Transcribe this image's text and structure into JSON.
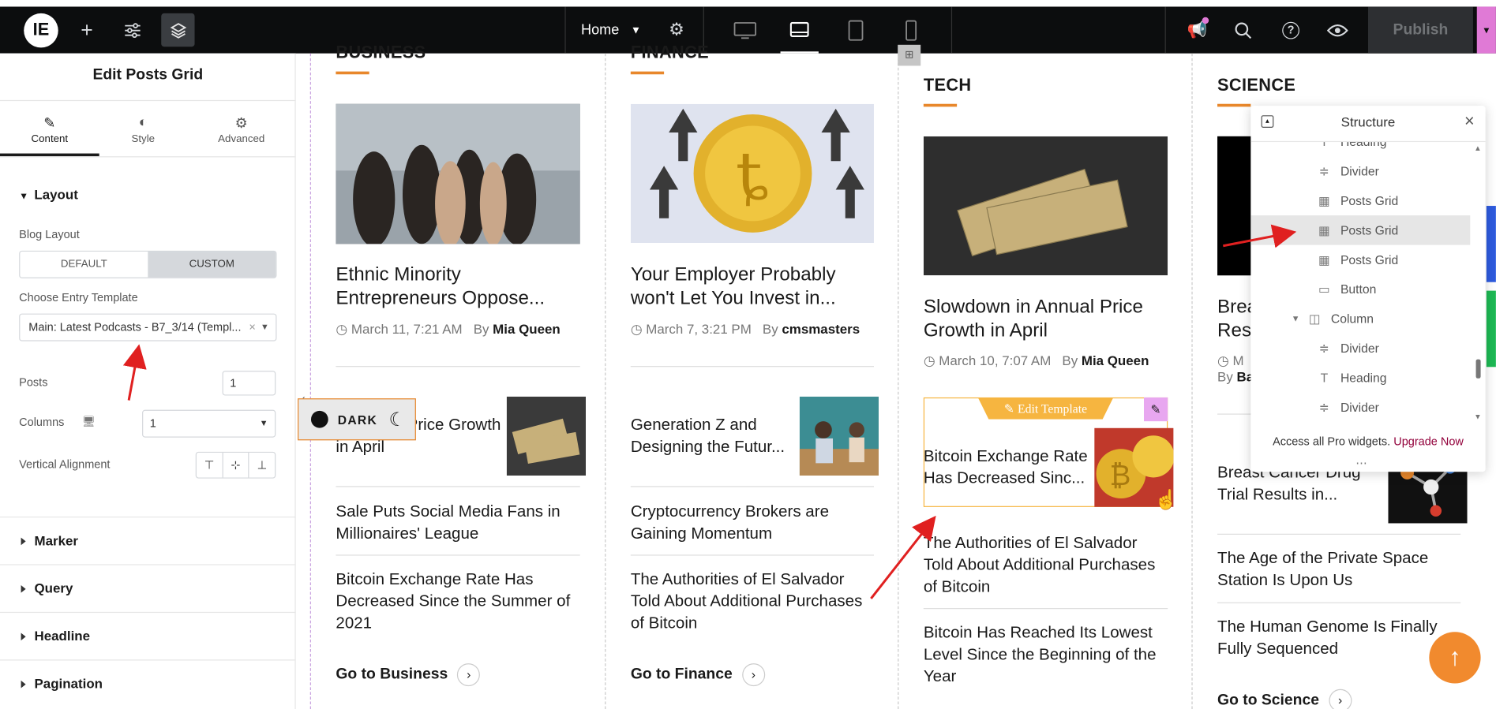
{
  "topbar": {
    "page_label": "Home",
    "publish_label": "Publish"
  },
  "panel": {
    "title": "Edit Posts Grid",
    "tabs": [
      {
        "label": "Content"
      },
      {
        "label": "Style"
      },
      {
        "label": "Advanced"
      }
    ],
    "layout_section": "Layout",
    "blog_layout_label": "Blog Layout",
    "blog_layout_options": [
      "DEFAULT",
      "CUSTOM"
    ],
    "entry_template_label": "Choose Entry Template",
    "entry_template_value": "Main: Latest Podcasts - B7_3/14 (Templ...",
    "posts_label": "Posts",
    "posts_value": "1",
    "columns_label": "Columns",
    "columns_value": "1",
    "valign_label": "Vertical Alignment",
    "sections": [
      "Marker",
      "Query",
      "Headline",
      "Pagination"
    ]
  },
  "dark_toggle": "DARK",
  "columns": [
    {
      "category": "BUSINESS",
      "feature_title": "Ethnic Minority Entrepreneurs Oppose...",
      "feature_date": "March 11, 7:21 AM",
      "feature_author": "Mia Queen",
      "list": [
        "in Annual Price Growth in April",
        "Sale Puts Social Media Fans in Millionaires' League",
        "Bitcoin Exchange Rate Has Decreased Since the Summer of 2021"
      ],
      "goto": "Go to Business"
    },
    {
      "category": "FINANCE",
      "feature_title": "Your Employer Probably won't Let You Invest in...",
      "feature_date": "March 7, 3:21 PM",
      "feature_author": "cmsmasters",
      "list": [
        "Generation Z and Designing the Futur...",
        "Cryptocurrency Brokers are Gaining Momentum",
        "The Authorities of El Salvador Told About Additional Purchases of Bitcoin"
      ],
      "goto": "Go to Finance"
    },
    {
      "category": "TECH",
      "feature_title": "Slowdown in Annual Price Growth in April",
      "feature_date": "March 10, 7:07 AM",
      "feature_author": "Mia Queen",
      "list": [
        "Bitcoin Exchange Rate Has Decreased Sinc...",
        "The Authorities of El Salvador Told About Additional Purchases of Bitcoin",
        "Bitcoin Has Reached Its Lowest Level Since the Beginning of the Year"
      ],
      "edit_template": "Edit Template"
    },
    {
      "category": "SCIENCE",
      "feature_title_partial": "Brea Res",
      "feature_date_partial": "M",
      "feature_author_partial": "Ba",
      "list": [
        "Breast Cancer Drug Trial Results in...",
        "The Age of the Private Space Station Is Upon Us",
        "The Human Genome Is Finally Fully Sequenced"
      ],
      "goto": "Go to Science"
    }
  ],
  "by_label": "By",
  "structure": {
    "title": "Structure",
    "items": [
      "Heading",
      "Divider",
      "Posts Grid",
      "Posts Grid",
      "Posts Grid",
      "Button",
      "Column",
      "Divider",
      "Heading",
      "Divider"
    ],
    "footer_text": "Access all Pro widgets.",
    "upgrade_label": "Upgrade Now"
  },
  "colors": {
    "accent": "#e8872b",
    "upgrade": "#92003b",
    "topbar": "#0c0d0e",
    "edit_template": "#f6b540"
  }
}
